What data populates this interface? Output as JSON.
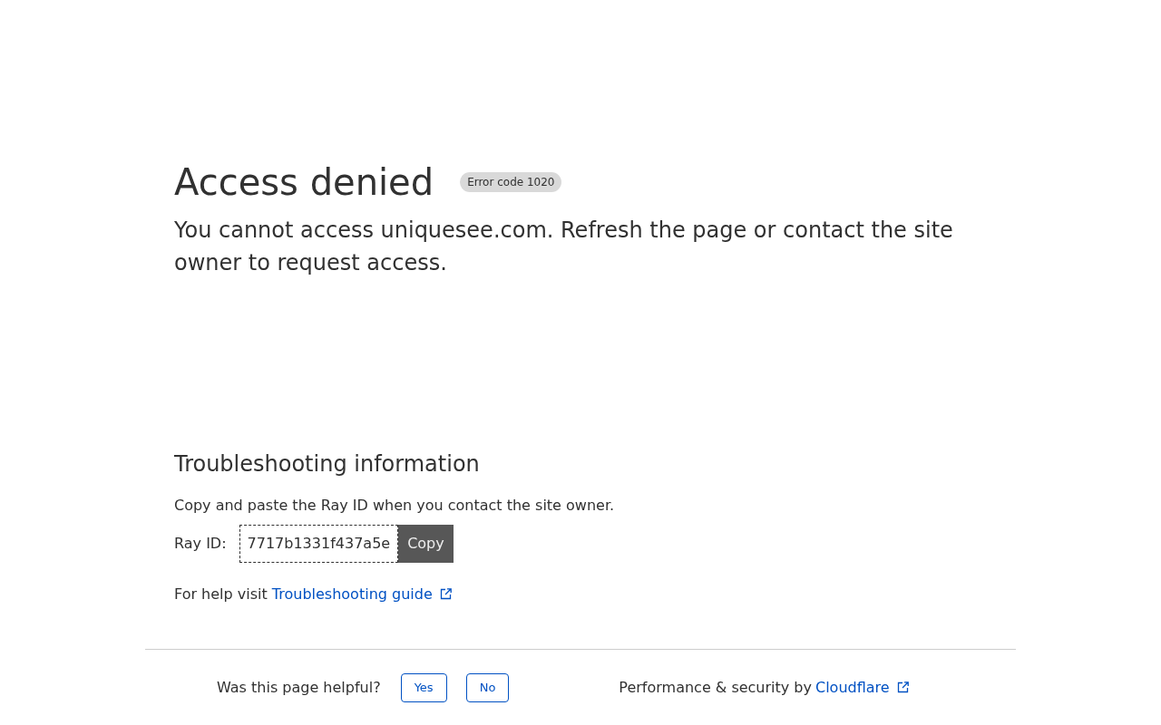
{
  "header": {
    "title": "Access denied",
    "badge": "Error code 1020",
    "message": "You cannot access uniquesee.com. Refresh the page or contact the site owner to request access."
  },
  "troubleshooting": {
    "title": "Troubleshooting information",
    "instruction": "Copy and paste the Ray ID when you contact the site owner.",
    "ray_id_label": "Ray ID:",
    "ray_id": "7717b1331f437a5e",
    "copy_button": "Copy",
    "help_text": "For help visit",
    "help_link": "Troubleshooting guide"
  },
  "footer": {
    "question": "Was this page helpful?",
    "buttons": [
      "Yes",
      "No"
    ],
    "credit": "Performance & security by",
    "credit_link": "Cloudflare"
  }
}
